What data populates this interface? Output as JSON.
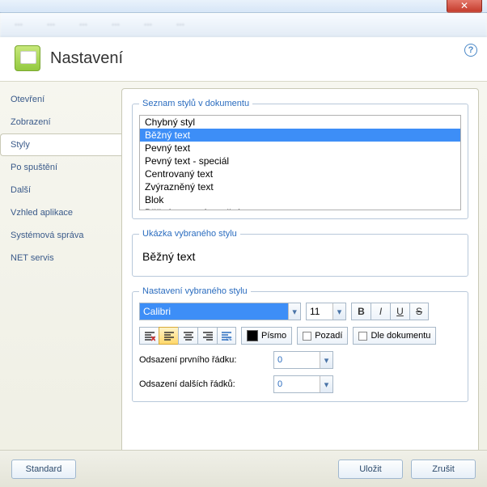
{
  "window": {
    "title": "Nastavení"
  },
  "sidebar": {
    "items": [
      {
        "label": "Otevření"
      },
      {
        "label": "Zobrazení"
      },
      {
        "label": "Styly"
      },
      {
        "label": "Po spuštění"
      },
      {
        "label": "Další"
      },
      {
        "label": "Vzhled aplikace"
      },
      {
        "label": "Systémová správa"
      },
      {
        "label": "NET servis"
      }
    ],
    "selected_index": 2
  },
  "fieldsets": {
    "list_legend": "Seznam stylů v dokumentu",
    "preview_legend": "Ukázka vybraného stylu",
    "settings_legend": "Nastavení vybraného stylu"
  },
  "styles": {
    "items": [
      "Chybný styl",
      "Běžný text",
      "Pevný text",
      "Pevný text - speciál",
      "Centrovaný text",
      "Zvýrazněný text",
      "Blok",
      "Běžný text zvýraznění"
    ],
    "selected_index": 1
  },
  "preview_text": "Běžný text",
  "font": {
    "name": "Calibri",
    "size": "11"
  },
  "buttons": {
    "pismo": "Písmo",
    "pozadi": "Pozadí",
    "dle_dok": "Dle dokumentu",
    "standard": "Standard",
    "ulozit": "Uložit",
    "zrusit": "Zrušit"
  },
  "labels": {
    "indent_first": "Odsazení prvního řádku:",
    "indent_other": "Odsazení dalších řádků:"
  },
  "indent": {
    "first": "0",
    "other": "0"
  }
}
